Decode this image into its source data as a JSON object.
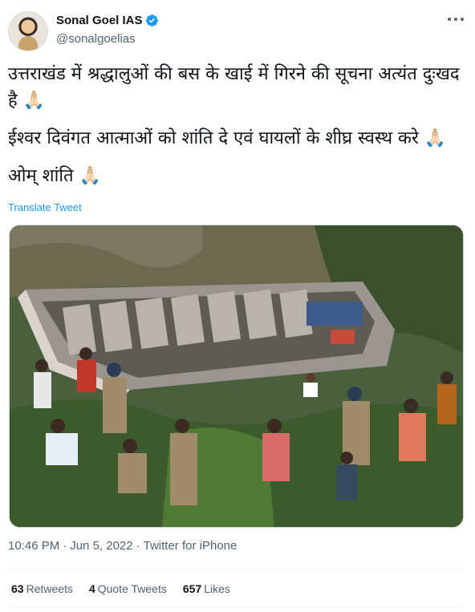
{
  "author": {
    "name": "Sonal Goel IAS",
    "handle": "@sonalgoelias"
  },
  "tweet": {
    "line1": "उत्तराखंड में श्रद्धालुओं की बस के खाई में गिरने की सूचना अत्यंत दुःखद है 🙏🏻",
    "line2": "ईश्वर दिवंगत आत्माओं को शांति दे एवं घायलों के शीघ्र स्वस्थ करे 🙏🏻",
    "line3": "ओम् शांति 🙏🏻"
  },
  "translate_label": "Translate Tweet",
  "meta": {
    "time": "10:46 PM",
    "date": "Jun 5, 2022",
    "source": "Twitter for iPhone"
  },
  "stats": {
    "retweets_count": "63",
    "retweets_label": "Retweets",
    "quotes_count": "4",
    "quotes_label": "Quote Tweets",
    "likes_count": "657",
    "likes_label": "Likes"
  },
  "colors": {
    "accent": "#1d9bf0",
    "secondary_text": "#536471",
    "primary_text": "#0f1419"
  },
  "icons": {
    "verified": "verified-badge-icon",
    "more": "more-options-icon"
  }
}
